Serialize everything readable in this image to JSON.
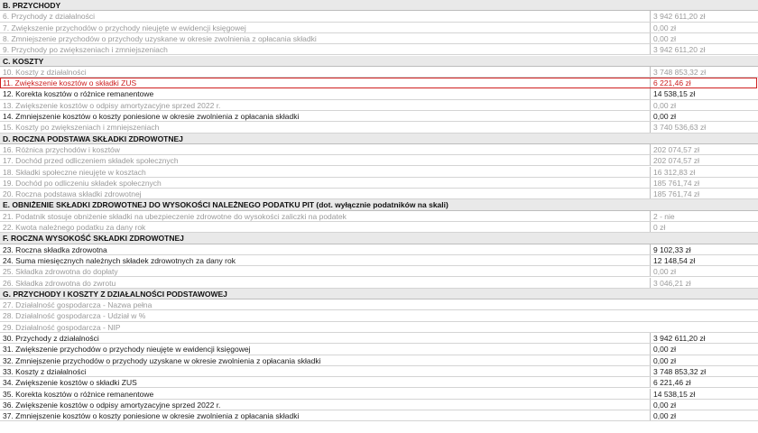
{
  "rows": [
    {
      "type": "section",
      "label": "B. PRZYCHODY"
    },
    {
      "type": "muted",
      "label": "6. Przychody z działalności",
      "value": "3 942 611,20 zł"
    },
    {
      "type": "muted",
      "label": "7. Zwiększenie przychodów o przychody nieujęte w ewidencji księgowej",
      "value": "0,00 zł"
    },
    {
      "type": "muted",
      "label": "8. Zmniejszenie przychodów o przychody uzyskane w okresie zwolnienia z opłacania składki",
      "value": "0,00 zł"
    },
    {
      "type": "muted",
      "label": "9. Przychody po zwiększeniach i zmniejszeniach",
      "value": "3 942 611,20 zł"
    },
    {
      "type": "section",
      "label": "C. KOSZTY"
    },
    {
      "type": "muted",
      "label": "10. Koszty z działalności",
      "value": "3 748 853,32 zł"
    },
    {
      "type": "highlight",
      "label": "11. Zwiększenie kosztów o składki ZUS",
      "value": "6 221,46 zł"
    },
    {
      "type": "dark",
      "label": "12. Korekta kosztów o różnice remanentowe",
      "value": "14 538,15 zł"
    },
    {
      "type": "muted",
      "label": "13. Zwiększenie kosztów o odpisy amortyzacyjne sprzed 2022 r.",
      "value": "0,00 zł"
    },
    {
      "type": "dark",
      "label": "14. Zmniejszenie kosztów o koszty poniesione w okresie zwolnienia z opłacania składki",
      "value": "0,00 zł"
    },
    {
      "type": "muted",
      "label": "15. Koszty po zwiększeniach i zmniejszeniach",
      "value": "3 740 536,63 zł"
    },
    {
      "type": "section",
      "label": "D. ROCZNA PODSTAWA SKŁADKI ZDROWOTNEJ"
    },
    {
      "type": "muted",
      "label": "16. Różnica przychodów i kosztów",
      "value": "202 074,57 zł"
    },
    {
      "type": "muted",
      "label": "17. Dochód przed odliczeniem składek społecznych",
      "value": "202 074,57 zł"
    },
    {
      "type": "muted",
      "label": "18. Składki społeczne nieujęte w kosztach",
      "value": "16 312,83 zł"
    },
    {
      "type": "muted",
      "label": "19. Dochód po odliczeniu składek społecznych",
      "value": "185 761,74 zł"
    },
    {
      "type": "muted",
      "label": "20. Roczna podstawa składki zdrowotnej",
      "value": "185 761,74 zł"
    },
    {
      "type": "section",
      "label": "E. OBNIŻENIE SKŁADKI ZDROWOTNEJ DO WYSOKOŚCI NALEŻNEGO PODATKU PIT (dot. wyłącznie podatników na skali)"
    },
    {
      "type": "muted",
      "label": "21. Podatnik stosuje obniżenie składki na ubezpieczenie zdrowotne do wysokości zaliczki na podatek",
      "value": "2 - nie"
    },
    {
      "type": "muted",
      "label": "22. Kwota należnego podatku za dany rok",
      "value": "0 zł"
    },
    {
      "type": "section",
      "label": "F. ROCZNA WYSOKOŚĆ SKŁADKI ZDROWOTNEJ"
    },
    {
      "type": "dark",
      "label": "23. Roczna składka zdrowotna",
      "value": "9 102,33 zł"
    },
    {
      "type": "dark",
      "label": "24. Suma miesięcznych należnych składek zdrowotnych za dany rok",
      "value": "12 148,54 zł"
    },
    {
      "type": "muted",
      "label": "25. Składka zdrowotna do dopłaty",
      "value": "0,00 zł"
    },
    {
      "type": "muted",
      "label": "26. Składka zdrowotna do zwrotu",
      "value": "3 046,21 zł"
    },
    {
      "type": "section",
      "label": "G. PRZYCHODY I KOSZTY Z DZIAŁALNOŚCI PODSTAWOWEJ"
    },
    {
      "type": "muted",
      "label": "27. Działalność gospodarcza - Nazwa pełna",
      "value": ""
    },
    {
      "type": "muted",
      "label": "28. Działalność gospodarcza - Udział w %",
      "value": ""
    },
    {
      "type": "muted",
      "label": "29. Działalność gospodarcza - NIP",
      "value": ""
    },
    {
      "type": "dark",
      "label": "30. Przychody z działalności",
      "value": "3 942 611,20 zł"
    },
    {
      "type": "dark",
      "label": "31. Zwiększenie przychodów o przychody nieujęte w ewidencji księgowej",
      "value": "0,00 zł"
    },
    {
      "type": "dark",
      "label": "32. Zmniejszenie przychodów o przychody uzyskane w okresie zwolnienia z opłacania składki",
      "value": "0,00 zł"
    },
    {
      "type": "dark",
      "label": "33. Koszty z działalności",
      "value": "3 748 853,32 zł"
    },
    {
      "type": "dark",
      "label": "34. Zwiększenie kosztów o składki ZUS",
      "value": "6 221,46 zł"
    },
    {
      "type": "dark",
      "label": "35. Korekta kosztów o różnice remanentowe",
      "value": "14 538,15 zł"
    },
    {
      "type": "dark",
      "label": "36. Zwiększenie kosztów o odpisy amortyzacyjne sprzed 2022 r.",
      "value": "0,00 zł"
    },
    {
      "type": "dark",
      "label": "37. Zmniejszenie kosztów o koszty poniesione w okresie zwolnienia z opłacania składki",
      "value": "0,00 zł"
    }
  ]
}
